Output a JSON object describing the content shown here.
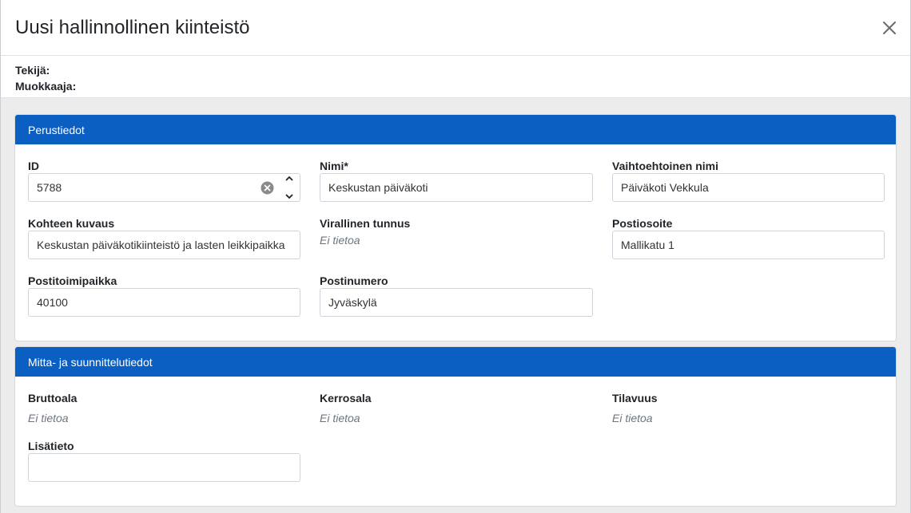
{
  "modal": {
    "title": "Uusi hallinnollinen kiinteistö",
    "creator_label": "Tekijä:",
    "editor_label": "Muokkaaja:"
  },
  "basic": {
    "header": "Perustiedot",
    "id_label": "ID",
    "id_value": "5788",
    "name_label": "Nimi*",
    "name_value": "Keskustan päiväkoti",
    "alt_name_label": "Vaihtoehtoinen nimi",
    "alt_name_value": "Päiväkoti Vekkula",
    "description_label": "Kohteen kuvaus",
    "description_value": "Keskustan päiväkotikiinteistö ja lasten leikkipaikka",
    "official_id_label": "Virallinen tunnus",
    "official_id_value": "Ei tietoa",
    "address_label": "Postiosoite",
    "address_value": "Mallikatu 1",
    "post_office_label": "Postitoimipaikka",
    "post_office_value": "40100",
    "postal_code_label": "Postinumero",
    "postal_code_value": "Jyväskylä"
  },
  "measurements": {
    "header": "Mitta- ja suunnittelutiedot",
    "gross_area_label": "Bruttoala",
    "gross_area_value": "Ei tietoa",
    "floor_area_label": "Kerrosala",
    "floor_area_value": "Ei tietoa",
    "volume_label": "Tilavuus",
    "volume_value": "Ei tietoa",
    "extra_label": "Lisätieto",
    "extra_value": ""
  },
  "icons": {
    "close": "close-icon",
    "clear": "clear-circle-icon",
    "increment": "chevron-up-icon",
    "decrement": "chevron-down-icon"
  },
  "colors": {
    "card_header": "#0c5fc2",
    "body_background": "#ececec"
  }
}
